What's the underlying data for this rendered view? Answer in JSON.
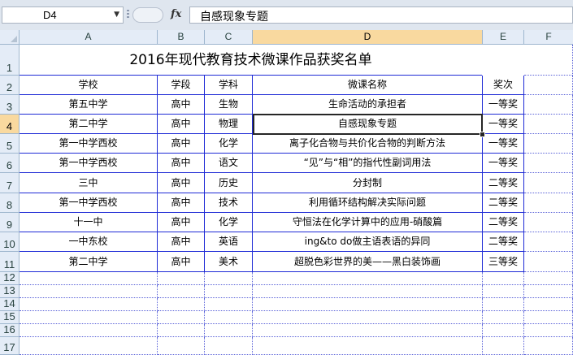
{
  "formula_bar": {
    "cell_ref": "D4",
    "fx_label": "fx",
    "content": "自感现象专题"
  },
  "columns": [
    "A",
    "B",
    "C",
    "D",
    "E",
    "F"
  ],
  "selected_column": "D",
  "row_numbers": [
    "1",
    "2",
    "3",
    "4",
    "5",
    "6",
    "7",
    "8",
    "9",
    "10",
    "11",
    "12",
    "13",
    "14",
    "15",
    "16",
    "17"
  ],
  "selected_row": "4",
  "sheet_title": "2016年现代教育技术微课作品获奖名单",
  "headers": [
    "学校",
    "学段",
    "学科",
    "微课名称",
    "奖次"
  ],
  "rows": [
    [
      "第五中学",
      "高中",
      "生物",
      "生命活动的承担者",
      "一等奖"
    ],
    [
      "第二中学",
      "高中",
      "物理",
      "自感现象专题",
      "一等奖"
    ],
    [
      "第一中学西校",
      "高中",
      "化学",
      "离子化合物与共价化合物的判断方法",
      "一等奖"
    ],
    [
      "第一中学西校",
      "高中",
      "语文",
      "“见”与“相”的指代性副词用法",
      "一等奖"
    ],
    [
      "三中",
      "高中",
      "历史",
      "分封制",
      "二等奖"
    ],
    [
      "第一中学西校",
      "高中",
      "技术",
      "利用循环结构解决实际问题",
      "二等奖"
    ],
    [
      "十一中",
      "高中",
      "化学",
      "守恒法在化学计算中的应用-硝酸篇",
      "二等奖"
    ],
    [
      "一中东校",
      "高中",
      "英语",
      "ing&to do做主语表语的异同",
      "二等奖"
    ],
    [
      "第二中学",
      "高中",
      "美术",
      "超脱色彩世界的美——黑白装饰画",
      "三等奖"
    ]
  ],
  "colors": {
    "grid_border": "#1f2bd6",
    "header_bg": "#e4ecf7",
    "selection": "#f9d99f"
  }
}
